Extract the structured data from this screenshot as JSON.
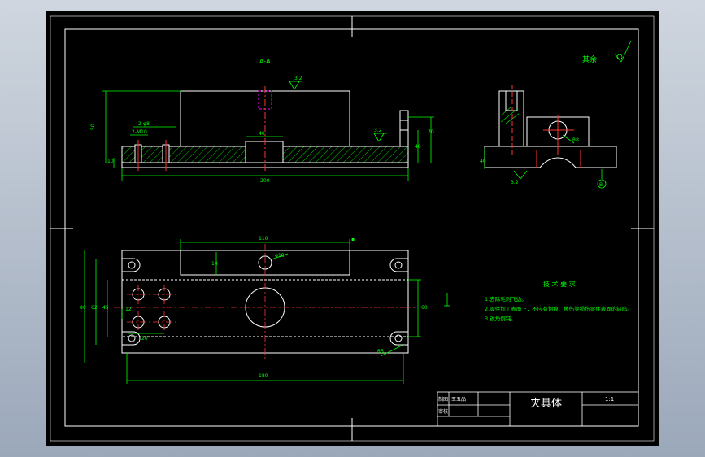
{
  "colors": {
    "background": "#000000",
    "geometry": "#ffffff",
    "dimension": "#00ff00",
    "centerline": "#ff3333",
    "hidden_hole": "#ff00ff",
    "hatch": "#00cc00",
    "border": "#ffffff"
  },
  "section_view": {
    "label": "A-A",
    "dims": {
      "overall_width": "200",
      "overall_height": "50",
      "base_height": "10",
      "slot_width": "40",
      "left_step_a": "2-φ8",
      "left_step_b": "2-M10",
      "right_h1": "40",
      "right_h2": "70",
      "roughness_top": "3.2",
      "roughness_right": "3.2"
    }
  },
  "side_view": {
    "dims": {
      "left_height": "40",
      "roughness_bottom": "3.2",
      "chamfer": "R8",
      "datum": "B"
    }
  },
  "plan_view": {
    "dims": {
      "top_width": "110",
      "bottom_width": "180",
      "left_outer": "80",
      "left_mid": "62",
      "left_inner": "45",
      "right_height": "60",
      "bottom_left_a": "12",
      "bottom_left_b": "20",
      "top_left_small": "14",
      "top_right_small": "φ18",
      "radius_br": "R5"
    }
  },
  "roughness_note": "其余",
  "tech_requirements": {
    "title": "技 术 要 求",
    "lines": [
      "1.去除毛刺飞边。",
      "2.零件加工表面上，不应有划痕、擦伤等损伤零件表面的缺陷。",
      "3.锐角倒钝。"
    ]
  },
  "title_block": {
    "row1_label": "制图",
    "row1_name": "王五品",
    "row2_label": "审核",
    "part_name": "夹具体",
    "scale": "1:1"
  }
}
